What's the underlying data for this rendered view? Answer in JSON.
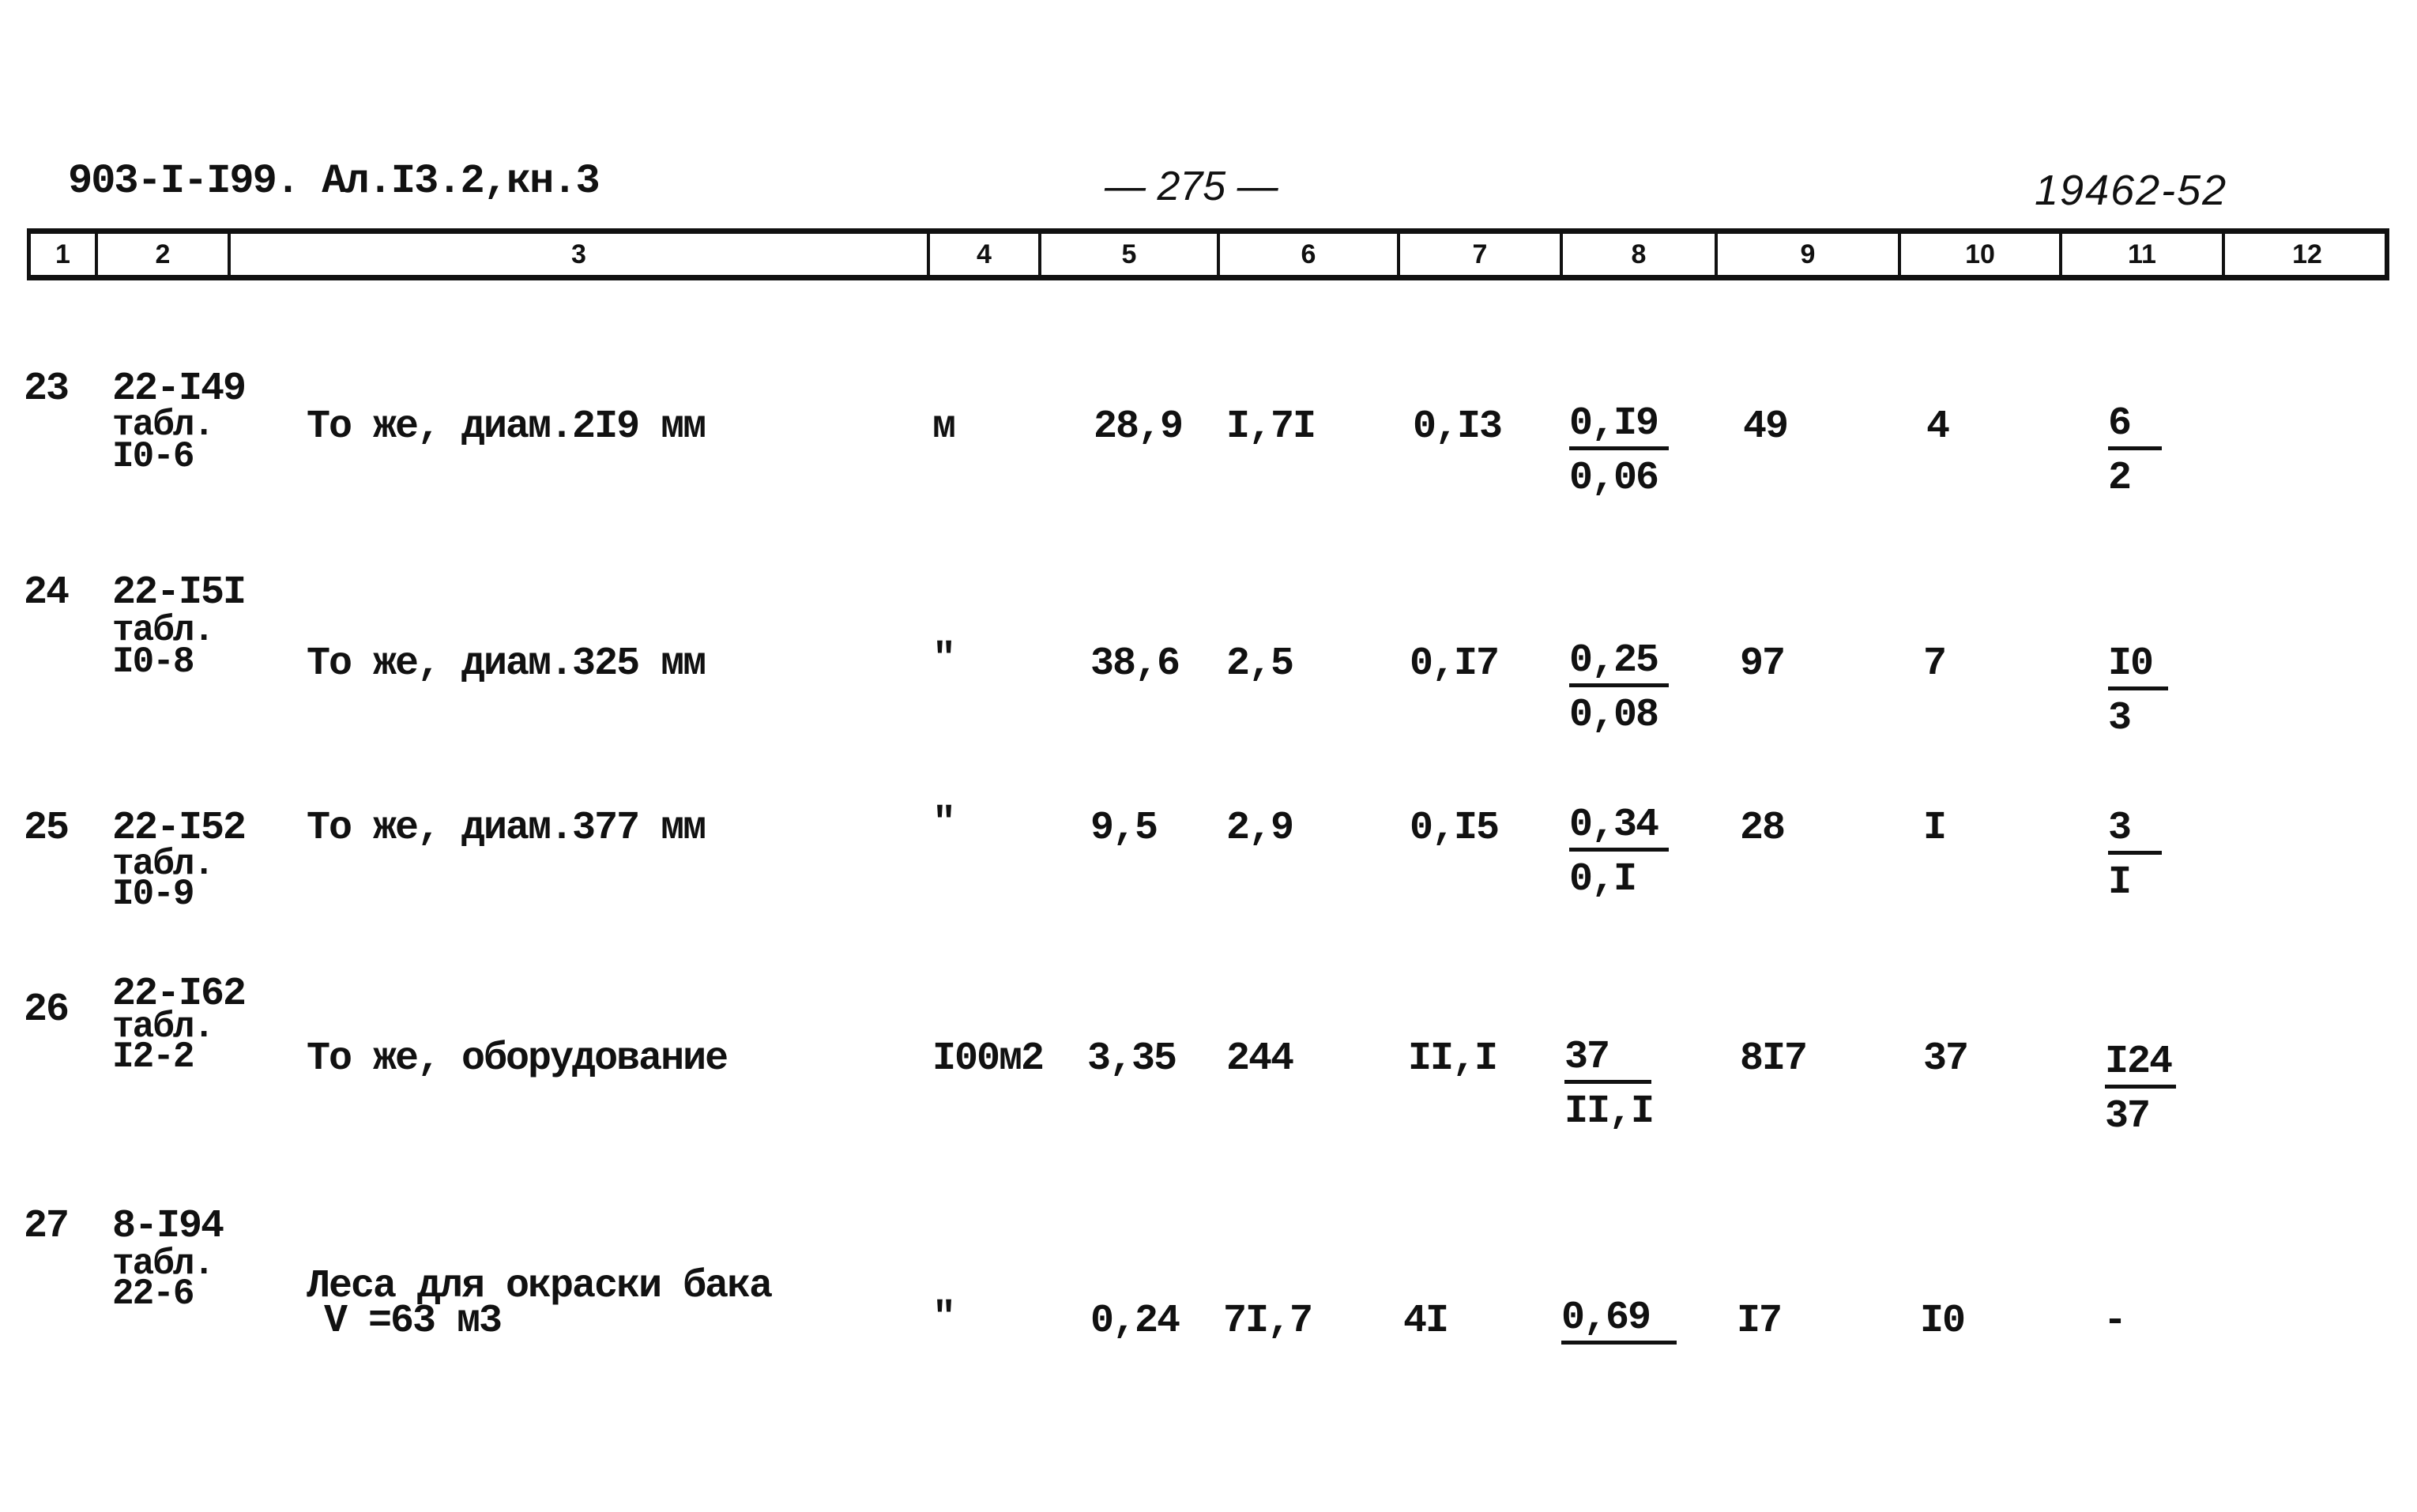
{
  "header": {
    "doc_ref": "903-I-I99. Ал.I3.2,кн.3",
    "page": "— 275 —",
    "code": "19462-52"
  },
  "column_headers": [
    "1",
    "2",
    "3",
    "4",
    "5",
    "6",
    "7",
    "8",
    "9",
    "10",
    "11",
    "12"
  ],
  "rows": [
    {
      "no": "23",
      "code": [
        "22-I49",
        "табл.",
        "I0-6"
      ],
      "description": [
        "То же, диам.2I9 мм"
      ],
      "unit": "м",
      "c5": "28,9",
      "c6": "I,7I",
      "c7": "0,I3",
      "c8_num": "0,I9",
      "c8_den": "0,06",
      "c9": "49",
      "c10": "4",
      "c11_num": "6",
      "c11_den": "2",
      "c12": ""
    },
    {
      "no": "24",
      "code": [
        "22-I5I",
        "табл.",
        "I0-8"
      ],
      "description": [
        "То же, диам.325 мм"
      ],
      "unit": "\"",
      "c5": "38,6",
      "c6": "2,5",
      "c7": "0,I7",
      "c8_num": "0,25",
      "c8_den": "0,08",
      "c9": "97",
      "c10": "7",
      "c11_num": "I0",
      "c11_den": "3",
      "c12": ""
    },
    {
      "no": "25",
      "code": [
        "22-I52",
        "табл.",
        "I0-9"
      ],
      "description": [
        "То же, диам.377 мм"
      ],
      "unit": "\"",
      "c5": "9,5",
      "c6": "2,9",
      "c7": "0,I5",
      "c8_num": "0,34",
      "c8_den": "0,I",
      "c9": "28",
      "c10": "I",
      "c11_num": "3",
      "c11_den": "I",
      "c12": ""
    },
    {
      "no": "26",
      "code": [
        "22-I62",
        "табл.",
        "I2-2"
      ],
      "description": [
        "То же, оборудование"
      ],
      "unit": "I00м2",
      "c5": "3,35",
      "c6": "244",
      "c7": "II,I",
      "c8_num": "37",
      "c8_den": "II,I",
      "c9": "8I7",
      "c10": "37",
      "c11_num": "I24",
      "c11_den": "37",
      "c12": ""
    },
    {
      "no": "27",
      "code": [
        "8-I94",
        "табл.",
        "22-6"
      ],
      "description": [
        "Леса для окраски бака",
        "V =63 м3"
      ],
      "unit": "\"",
      "c5": "0,24",
      "c6": "7I,7",
      "c7": "4I",
      "c8_num": "0,69",
      "c8_den": "",
      "c9": "I7",
      "c10": "I0",
      "c11_num": "-",
      "c11_den": "",
      "c12": ""
    }
  ]
}
